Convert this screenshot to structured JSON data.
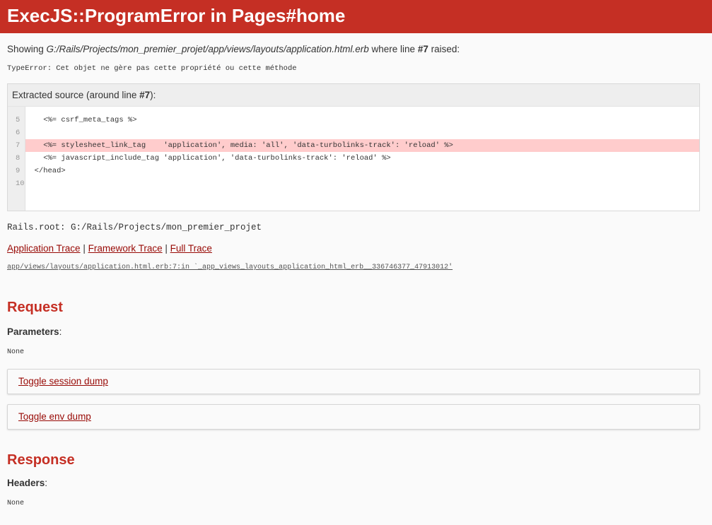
{
  "header": {
    "title": "ExecJS::ProgramError in Pages#home"
  },
  "showing": {
    "prefix": "Showing ",
    "path": "G:/Rails/Projects/mon_premier_projet/app/views/layouts/application.html.erb",
    "middle": " where line ",
    "line": "#7",
    "suffix": " raised:"
  },
  "error_message": "TypeError: Cet objet ne gère pas cette propriété ou cette méthode",
  "source": {
    "title_prefix": "Extracted source (around line ",
    "title_line": "#7",
    "title_suffix": "):",
    "line_numbers": [
      "5",
      "6",
      "7",
      "8",
      "9",
      "10"
    ],
    "lines": [
      "    <%= csrf_meta_tags %>",
      "",
      "    <%= stylesheet_link_tag    'application', media: 'all', 'data-turbolinks-track': 'reload' %>",
      "    <%= javascript_include_tag 'application', 'data-turbolinks-track': 'reload' %>",
      "  </head>",
      ""
    ],
    "highlight_index": 2,
    "highlight_color": "#ffcccc"
  },
  "rails_root": "Rails.root: G:/Rails/Projects/mon_premier_projet",
  "traces": {
    "application": "Application Trace",
    "framework": "Framework Trace",
    "full": "Full Trace",
    "separator": " | "
  },
  "trace_line": "app/views/layouts/application.html.erb:7:in `_app_views_layouts_application_html_erb__336746377_47913012'",
  "request": {
    "heading": "Request",
    "parameters_label": "Parameters",
    "parameters_value": "None",
    "toggle_session": "Toggle session dump",
    "toggle_env": "Toggle env dump"
  },
  "response": {
    "heading": "Response",
    "headers_label": "Headers",
    "headers_value": "None"
  },
  "colors": {
    "header_bg": "#c52f24",
    "link": "#980905"
  }
}
